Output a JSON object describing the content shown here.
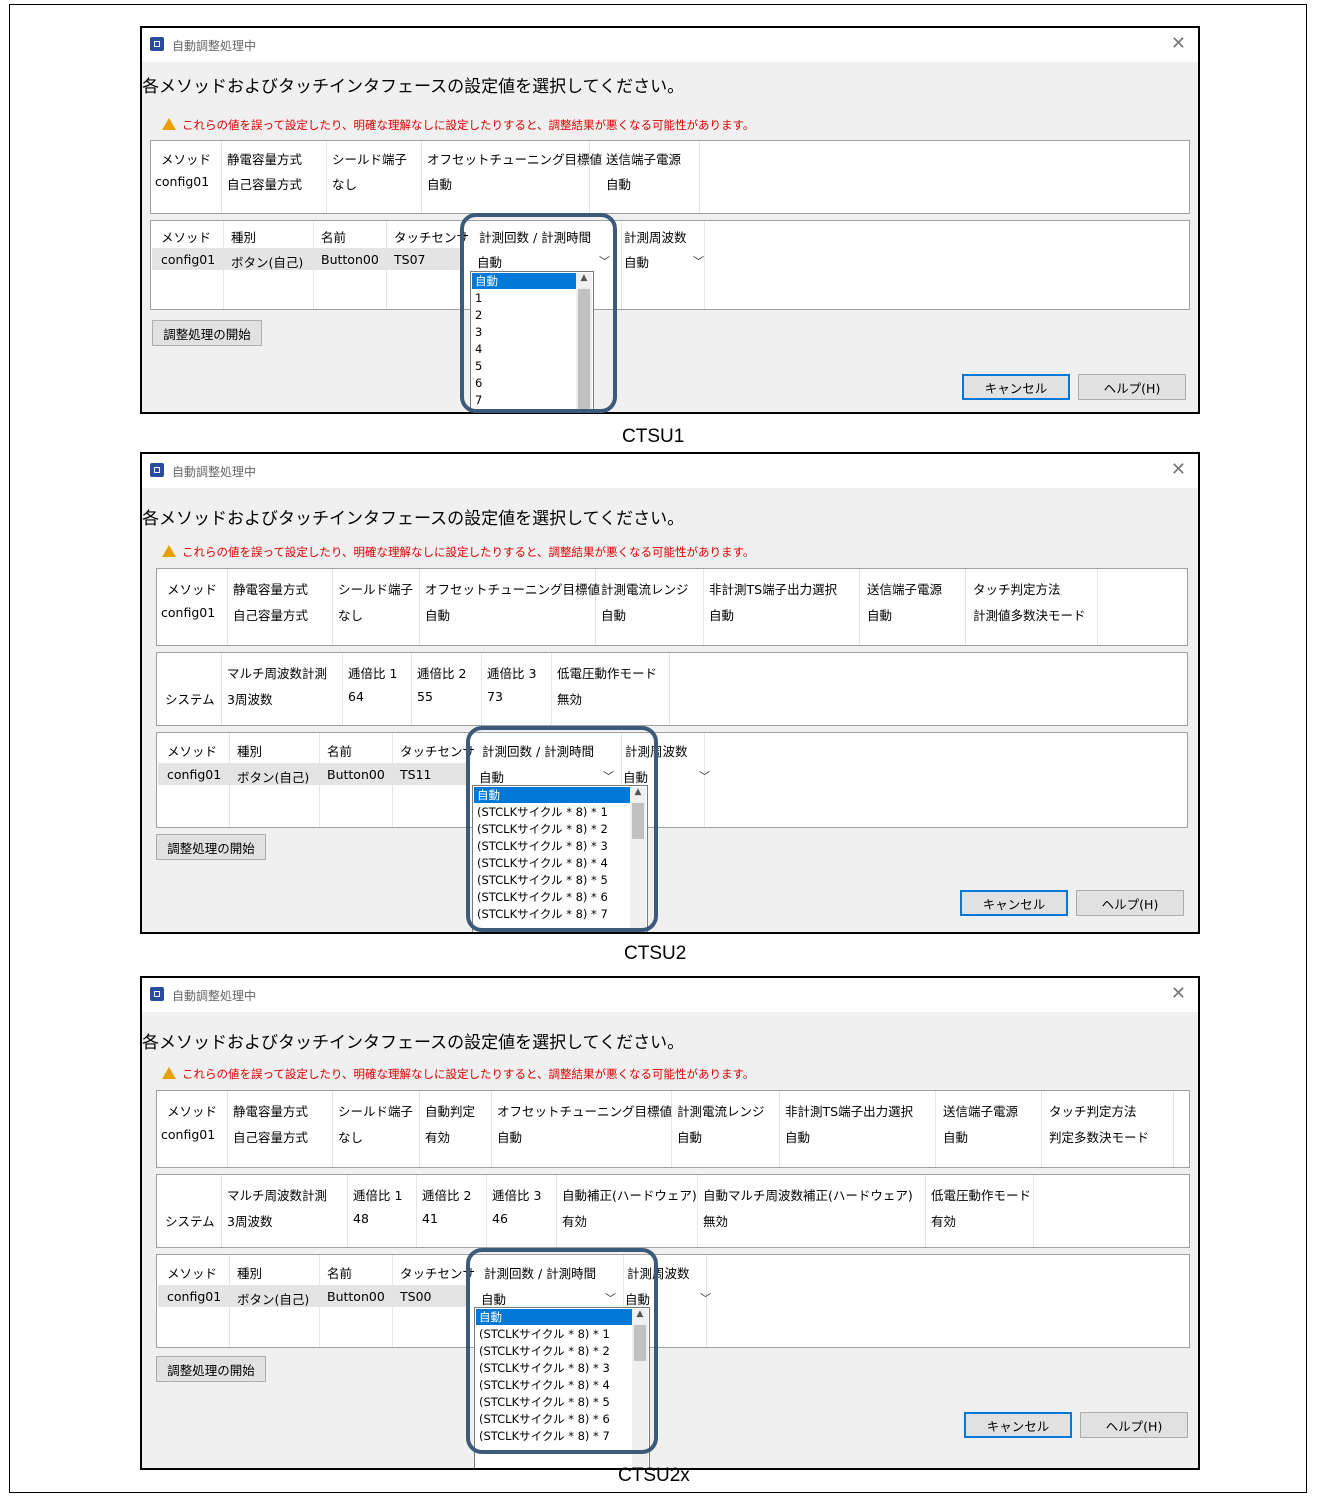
{
  "dialogs": [
    {
      "title": "自動調整処理中",
      "heading": "各メソッドおよびタッチインタフェースの設定値を選択してください。",
      "warning": "これらの値を誤って設定したり、明確な理解なしに設定したりすると、調整結果が悪くなる可能性があります。",
      "method_table": {
        "headers": [
          "メソッド",
          "静電容量方式",
          "シールド端子",
          "オフセットチューニング目標値",
          "送信端子電源"
        ],
        "row": [
          "config01",
          "自己容量方式",
          "なし",
          "自動",
          "自動"
        ]
      },
      "system_table": null,
      "touch_table": {
        "headers": [
          "メソッド",
          "種別",
          "名前",
          "タッチセンサ",
          "計測回数 / 計測時間",
          "計測周波数"
        ],
        "row": [
          "config01",
          "ボタン(自己)",
          "Button00",
          "TS07",
          "自動",
          "自動"
        ]
      },
      "dropdown_options": [
        "自動",
        "1",
        "2",
        "3",
        "4",
        "5",
        "6",
        "7"
      ],
      "start_button": "調整処理の開始",
      "cancel_button": "キャンセル",
      "help_button": "ヘルプ(H)",
      "caption": "CTSU1"
    },
    {
      "title": "自動調整処理中",
      "heading": "各メソッドおよびタッチインタフェースの設定値を選択してください。",
      "warning": "これらの値を誤って設定したり、明確な理解なしに設定したりすると、調整結果が悪くなる可能性があります。",
      "method_table": {
        "headers": [
          "メソッド",
          "静電容量方式",
          "シールド端子",
          "オフセットチューニング目標値",
          "計測電流レンジ",
          "非計測TS端子出力選択",
          "送信端子電源",
          "タッチ判定方法"
        ],
        "row": [
          "config01",
          "自己容量方式",
          "なし",
          "自動",
          "自動",
          "自動",
          "自動",
          "計測値多数決モード"
        ]
      },
      "system_table": {
        "headers": [
          "",
          "マルチ周波数計測",
          "逓倍比 1",
          "逓倍比 2",
          "逓倍比 3",
          "低電圧動作モード"
        ],
        "row": [
          "システム",
          "3周波数",
          "64",
          "55",
          "73",
          "無効"
        ]
      },
      "touch_table": {
        "headers": [
          "メソッド",
          "種別",
          "名前",
          "タッチセンサ",
          "計測回数 / 計測時間",
          "計測周波数"
        ],
        "row": [
          "config01",
          "ボタン(自己)",
          "Button00",
          "TS11",
          "自動",
          "自動"
        ]
      },
      "dropdown_options": [
        "自動",
        "(STCLKサイクル * 8) * 1",
        "(STCLKサイクル * 8) * 2",
        "(STCLKサイクル * 8) * 3",
        "(STCLKサイクル * 8) * 4",
        "(STCLKサイクル * 8) * 5",
        "(STCLKサイクル * 8) * 6",
        "(STCLKサイクル * 8) * 7"
      ],
      "start_button": "調整処理の開始",
      "cancel_button": "キャンセル",
      "help_button": "ヘルプ(H)",
      "caption": "CTSU2"
    },
    {
      "title": "自動調整処理中",
      "heading": "各メソッドおよびタッチインタフェースの設定値を選択してください。",
      "warning": "これらの値を誤って設定したり、明確な理解なしに設定したりすると、調整結果が悪くなる可能性があります。",
      "method_table": {
        "headers": [
          "メソッド",
          "静電容量方式",
          "シールド端子",
          "自動判定",
          "オフセットチューニング目標値",
          "計測電流レンジ",
          "非計測TS端子出力選択",
          "送信端子電源",
          "タッチ判定方法"
        ],
        "row": [
          "config01",
          "自己容量方式",
          "なし",
          "有効",
          "自動",
          "自動",
          "自動",
          "自動",
          "判定多数決モード"
        ]
      },
      "system_table": {
        "headers": [
          "",
          "マルチ周波数計測",
          "逓倍比 1",
          "逓倍比 2",
          "逓倍比 3",
          "自動補正(ハードウェア)",
          "自動マルチ周波数補正(ハードウェア)",
          "低電圧動作モード"
        ],
        "row": [
          "システム",
          "3周波数",
          "48",
          "41",
          "46",
          "有効",
          "無効",
          "有効"
        ]
      },
      "touch_table": {
        "headers": [
          "メソッド",
          "種別",
          "名前",
          "タッチセンサ",
          "計測回数 / 計測時間",
          "計測周波数"
        ],
        "row": [
          "config01",
          "ボタン(自己)",
          "Button00",
          "TS00",
          "自動",
          "自動"
        ]
      },
      "dropdown_options": [
        "自動",
        "(STCLKサイクル * 8) * 1",
        "(STCLKサイクル * 8) * 2",
        "(STCLKサイクル * 8) * 3",
        "(STCLKサイクル * 8) * 4",
        "(STCLKサイクル * 8) * 5",
        "(STCLKサイクル * 8) * 6",
        "(STCLKサイクル * 8) * 7"
      ],
      "start_button": "調整処理の開始",
      "cancel_button": "キャンセル",
      "help_button": "ヘルプ(H)",
      "caption": "CTSU2x"
    }
  ]
}
